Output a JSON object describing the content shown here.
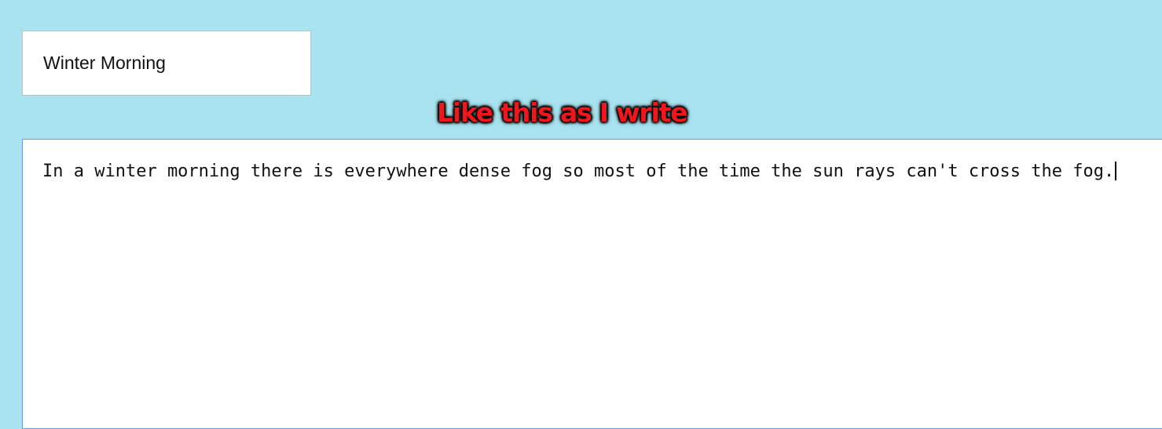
{
  "title_field": {
    "value": "Winter Morning"
  },
  "annotation": {
    "text": "Like this as I write"
  },
  "editor": {
    "text": "In a winter morning there is everywhere dense fog so most of the time the sun rays can't cross the fog."
  },
  "colors": {
    "background": "#a9e3ef",
    "annotation_text": "#f2151b",
    "editor_border_focus": "#6b9be0"
  }
}
